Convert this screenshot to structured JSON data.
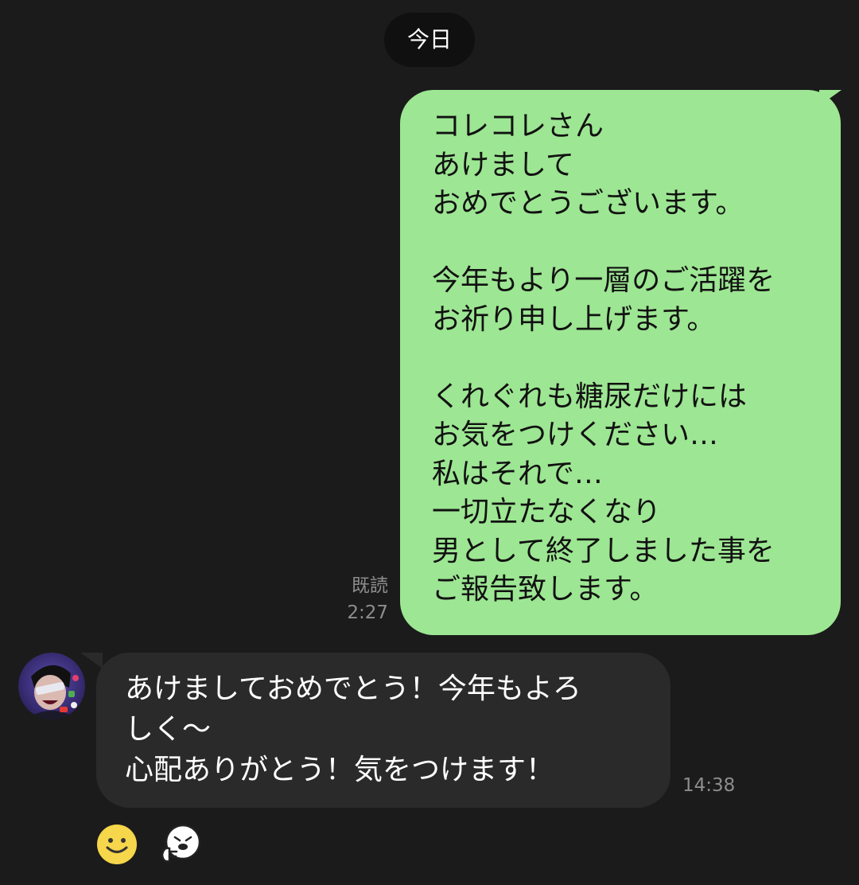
{
  "date_separator": "今日",
  "messages": [
    {
      "side": "sent",
      "text": "コレコレさん\nあけまして\nおめでとうございます。\n\n今年もより一層のご活躍を\nお祈り申し上げます。\n\nくれぐれも糖尿だけには\nお気をつけください…\n私はそれで…\n一切立たなくなり\n男として終了しました事を\nご報告致します。",
      "read_label": "既読",
      "time": "2:27"
    },
    {
      "side": "received",
      "text": "あけましておめでとう！今年もよろ\nしく～\n心配ありがとう！気をつけます！",
      "time": "14:38"
    }
  ],
  "colors": {
    "background": "#1b1b1b",
    "sent_bubble": "#9de693",
    "received_bubble": "#2a2a2a",
    "meta_text": "#8d8d8d"
  },
  "icons": {
    "avatar": "user-avatar",
    "reaction_1": "smiley-reaction-icon",
    "reaction_2": "sticker-thumbs-up-icon"
  }
}
